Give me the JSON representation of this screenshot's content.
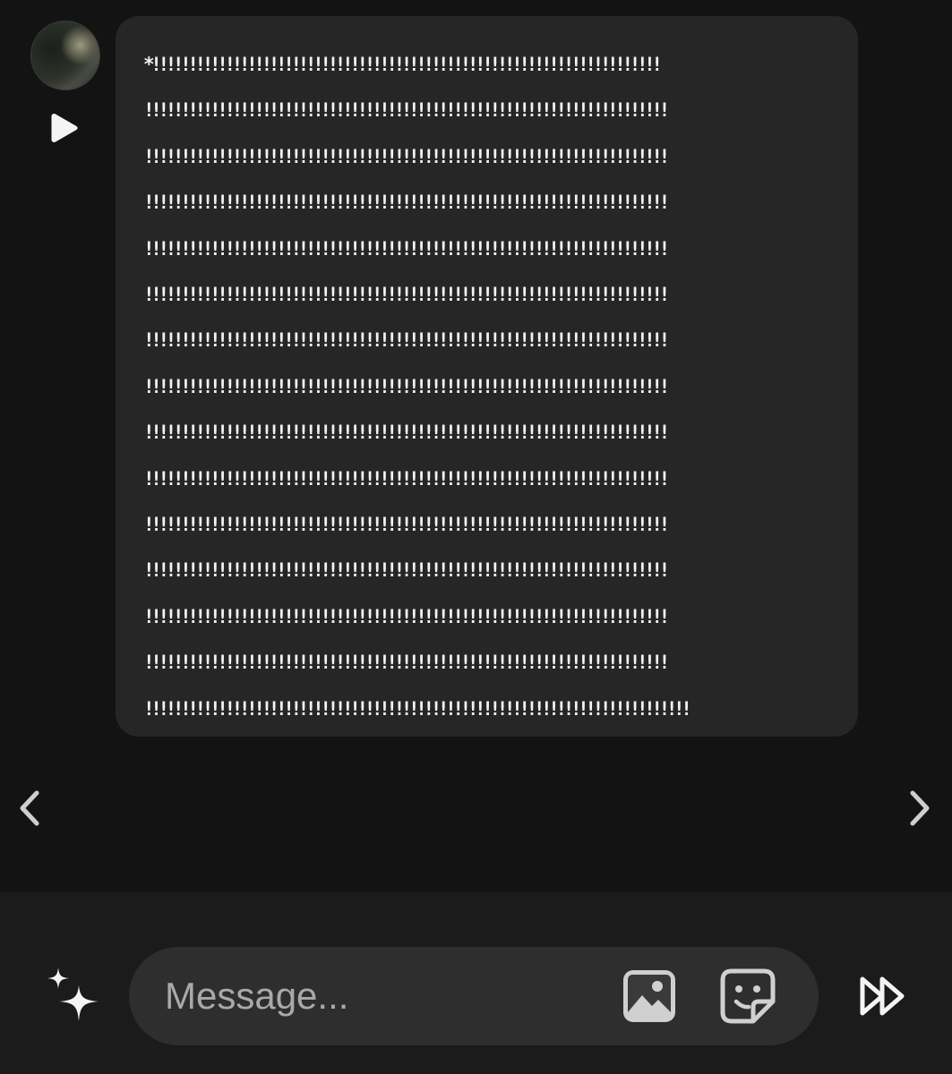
{
  "conversation": {
    "avatar_icon": "user-avatar",
    "play_icon": "play-icon",
    "message_text": "*!!!!!!!!!!!!!!!!!!!!!!!!!!!!!!!!!!!!!!!!!!!!!!!!!!!!!!!!!!!!!!!!!!!!!\n!!!!!!!!!!!!!!!!!!!!!!!!!!!!!!!!!!!!!!!!!!!!!!!!!!!!!!!!!!!!!!!!!!!!!!!\n!!!!!!!!!!!!!!!!!!!!!!!!!!!!!!!!!!!!!!!!!!!!!!!!!!!!!!!!!!!!!!!!!!!!!!!\n!!!!!!!!!!!!!!!!!!!!!!!!!!!!!!!!!!!!!!!!!!!!!!!!!!!!!!!!!!!!!!!!!!!!!!!\n!!!!!!!!!!!!!!!!!!!!!!!!!!!!!!!!!!!!!!!!!!!!!!!!!!!!!!!!!!!!!!!!!!!!!!!\n!!!!!!!!!!!!!!!!!!!!!!!!!!!!!!!!!!!!!!!!!!!!!!!!!!!!!!!!!!!!!!!!!!!!!!!\n!!!!!!!!!!!!!!!!!!!!!!!!!!!!!!!!!!!!!!!!!!!!!!!!!!!!!!!!!!!!!!!!!!!!!!!\n!!!!!!!!!!!!!!!!!!!!!!!!!!!!!!!!!!!!!!!!!!!!!!!!!!!!!!!!!!!!!!!!!!!!!!!\n!!!!!!!!!!!!!!!!!!!!!!!!!!!!!!!!!!!!!!!!!!!!!!!!!!!!!!!!!!!!!!!!!!!!!!!\n!!!!!!!!!!!!!!!!!!!!!!!!!!!!!!!!!!!!!!!!!!!!!!!!!!!!!!!!!!!!!!!!!!!!!!!\n!!!!!!!!!!!!!!!!!!!!!!!!!!!!!!!!!!!!!!!!!!!!!!!!!!!!!!!!!!!!!!!!!!!!!!!\n!!!!!!!!!!!!!!!!!!!!!!!!!!!!!!!!!!!!!!!!!!!!!!!!!!!!!!!!!!!!!!!!!!!!!!!\n!!!!!!!!!!!!!!!!!!!!!!!!!!!!!!!!!!!!!!!!!!!!!!!!!!!!!!!!!!!!!!!!!!!!!!!\n!!!!!!!!!!!!!!!!!!!!!!!!!!!!!!!!!!!!!!!!!!!!!!!!!!!!!!!!!!!!!!!!!!!!!!!\n!!!!!!!!!!!!!!!!!!!!!!!!!!!!!!!!!!!!!!!!!!!!!!!!!!!!!!!!!!!!!!!!!!!!!!!!!!",
    "prev_icon": "chevron-left-icon",
    "next_icon": "chevron-right-icon"
  },
  "composer": {
    "ai_icon": "sparkles-icon",
    "placeholder": "Message...",
    "value": "",
    "gallery_icon": "image-icon",
    "sticker_icon": "sticker-icon",
    "skip_icon": "fast-forward-icon"
  },
  "colors": {
    "background": "#131313",
    "bubble": "#262626",
    "composer_bar": "#1b1b1b",
    "input_pill": "#2e2e2e",
    "text": "#f2f2f2",
    "placeholder": "#a9a9a9"
  }
}
